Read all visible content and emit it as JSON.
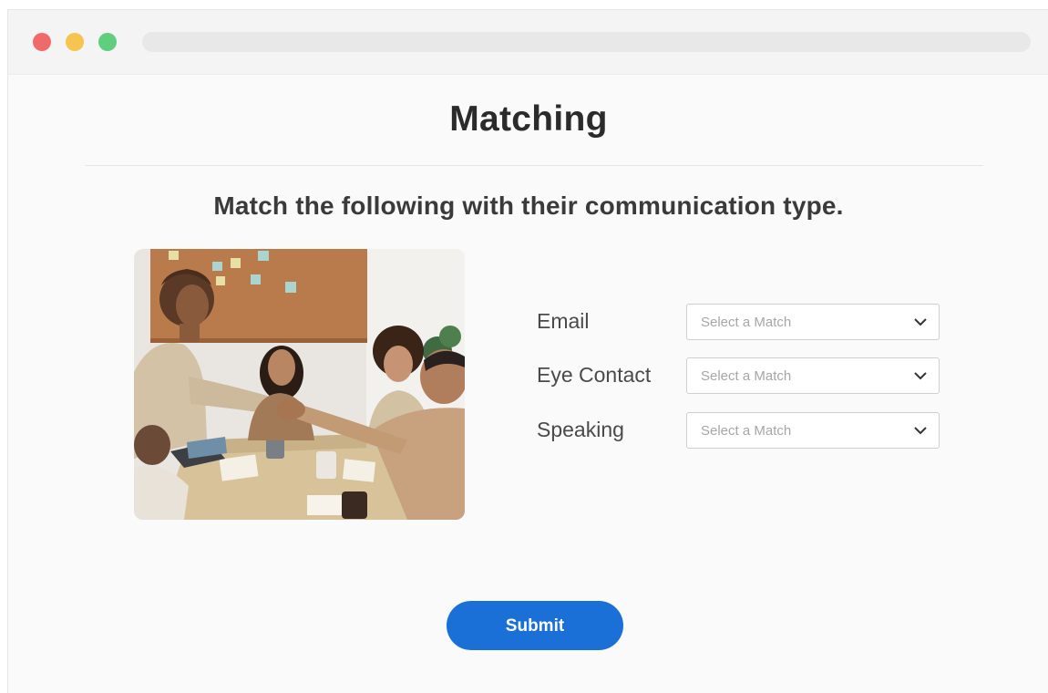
{
  "window": {
    "controls": [
      "close-dot",
      "minimize-dot",
      "maximize-dot"
    ]
  },
  "page": {
    "title": "Matching",
    "question": "Match the following with their communication type."
  },
  "matches": [
    {
      "label": "Email",
      "placeholder": "Select a Match"
    },
    {
      "label": "Eye Contact",
      "placeholder": "Select a Match"
    },
    {
      "label": "Speaking",
      "placeholder": "Select a Match"
    }
  ],
  "submit": {
    "label": "Submit"
  },
  "colors": {
    "accent": "#1a70d6",
    "close": "#ef6b6b",
    "minimize": "#f5c451",
    "maximize": "#5fcf7d"
  }
}
